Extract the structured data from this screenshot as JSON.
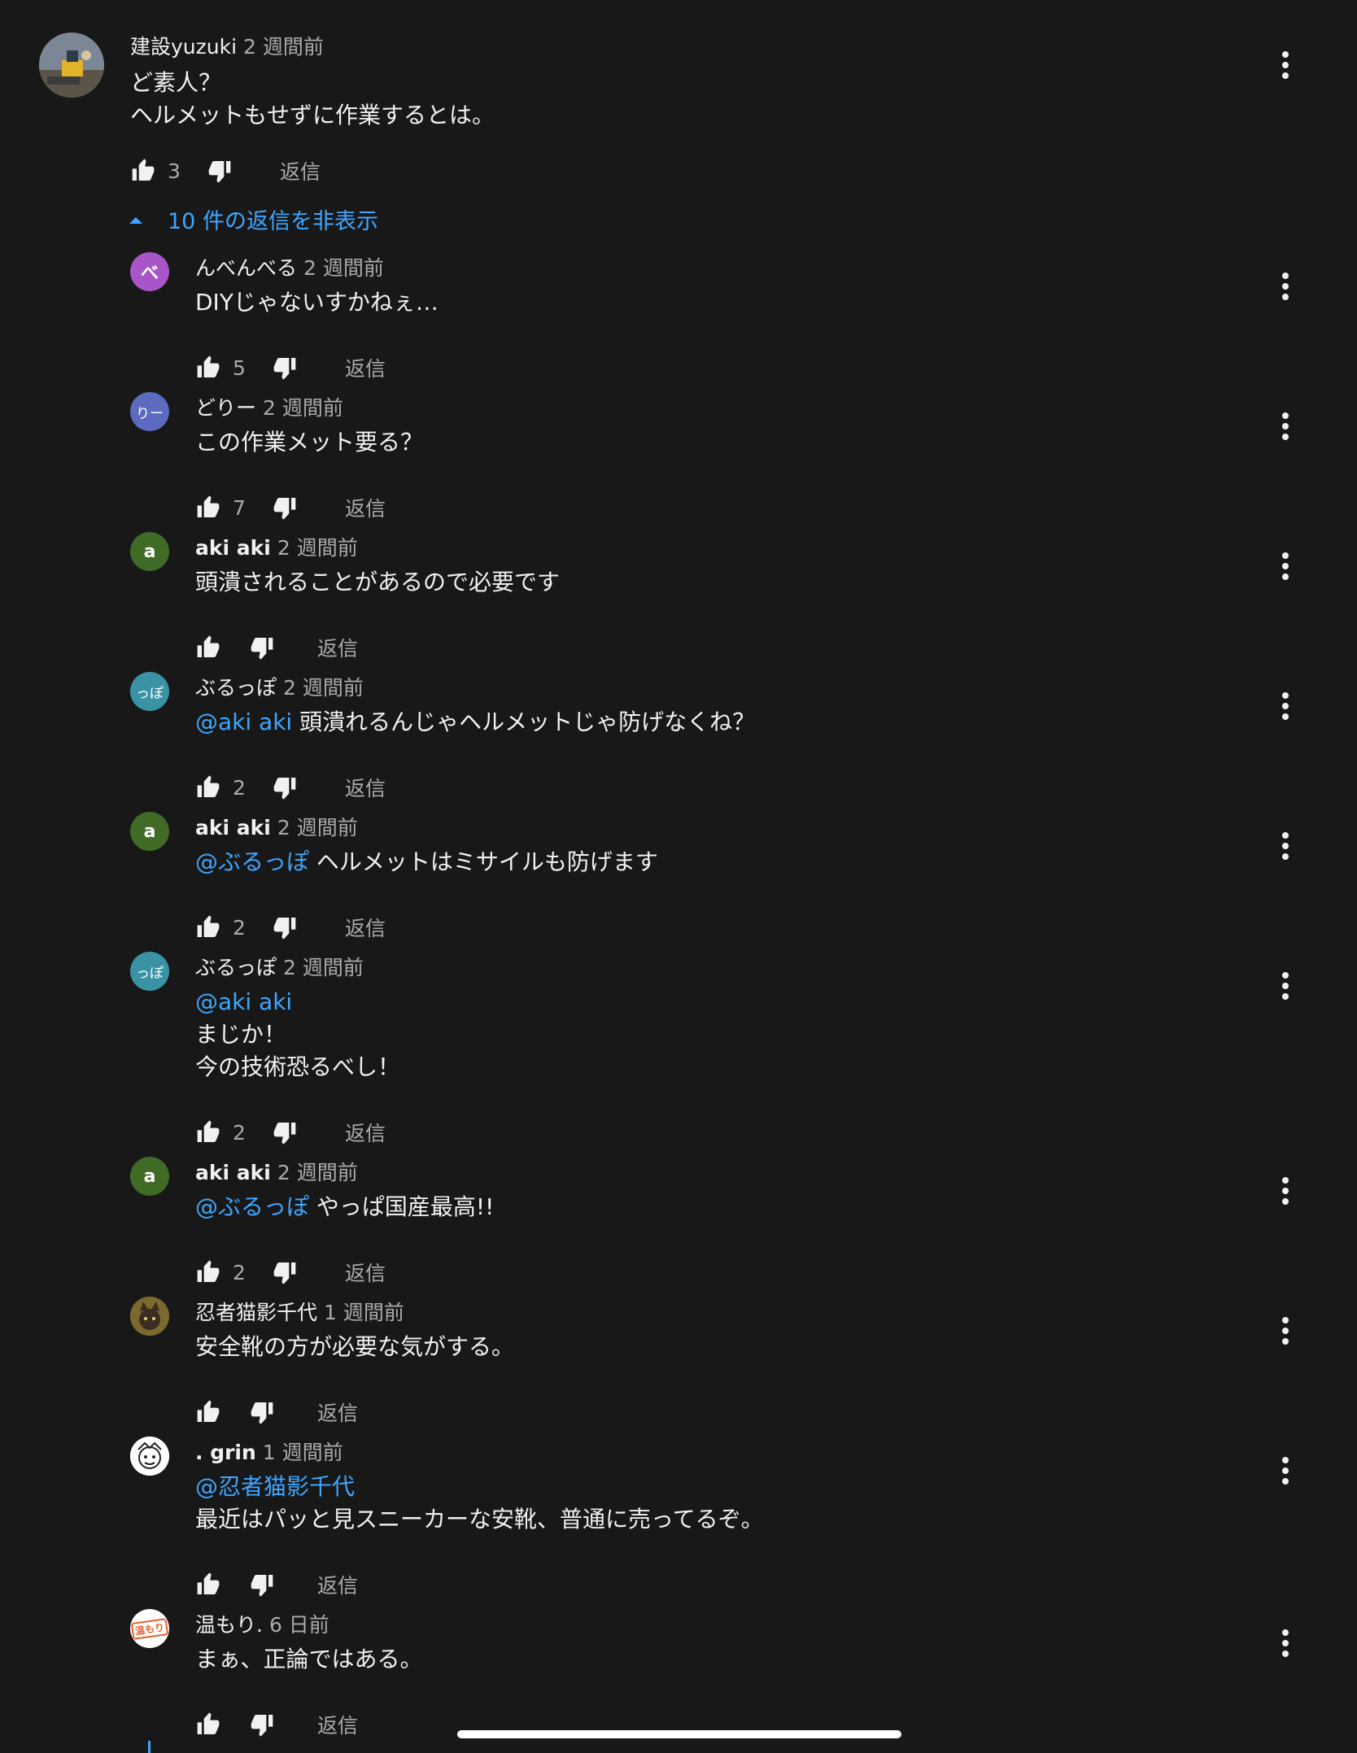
{
  "top_comment": {
    "author": "建設yuzuki",
    "time": "2 週間前",
    "text": "ど素人？\nヘルメットもせずに作業するとは。",
    "likes": "3",
    "reply_label": "返信",
    "avatar_icon": "construction-photo-avatar"
  },
  "replies_toggle": {
    "label": "10 件の返信を非表示",
    "icon": "caret-up-icon"
  },
  "replies": [
    {
      "author": "んべんべる",
      "author_bold": false,
      "time": "2 週間前",
      "mention": "",
      "text": "DIYじゃないすかねぇ…",
      "likes": "5",
      "reply_label": "返信",
      "avatar_text": "べ",
      "avatar_color": "#a855c8"
    },
    {
      "author": "どりー",
      "author_bold": false,
      "time": "2 週間前",
      "mention": "",
      "text": "この作業メット要る？",
      "likes": "7",
      "reply_label": "返信",
      "avatar_text": "りー",
      "avatar_color": "#5c6bc0"
    },
    {
      "author": "aki aki",
      "author_bold": true,
      "time": "2 週間前",
      "mention": "",
      "text": "頭潰されることがあるので必要です",
      "likes": "",
      "reply_label": "返信",
      "avatar_text": "a",
      "avatar_color": "#3f6b27"
    },
    {
      "author": "ぶるっぽ",
      "author_bold": false,
      "time": "2 週間前",
      "mention": "@aki aki",
      "text": "頭潰れるんじゃヘルメットじゃ防げなくね？",
      "likes": "2",
      "reply_label": "返信",
      "avatar_text": "っぽ",
      "avatar_color": "#3a93a4"
    },
    {
      "author": "aki aki",
      "author_bold": true,
      "time": "2 週間前",
      "mention": "@ぶるっぽ",
      "text": "ヘルメットはミサイルも防げます",
      "likes": "2",
      "reply_label": "返信",
      "avatar_text": "a",
      "avatar_color": "#3f6b27"
    },
    {
      "author": "ぶるっぽ",
      "author_bold": false,
      "time": "2 週間前",
      "mention": "@aki aki",
      "mention_newline": true,
      "text": "まじか！\n今の技術恐るべし！",
      "likes": "2",
      "reply_label": "返信",
      "avatar_text": "っぽ",
      "avatar_color": "#3a93a4"
    },
    {
      "author": "aki aki",
      "author_bold": true,
      "time": "2 週間前",
      "mention": "@ぶるっぽ",
      "text": "やっぱ国産最高!!",
      "likes": "2",
      "reply_label": "返信",
      "avatar_text": "a",
      "avatar_color": "#3f6b27"
    },
    {
      "author": "忍者猫影千代",
      "author_bold": false,
      "time": "1 週間前",
      "mention": "",
      "text": "安全靴の方が必要な気がする。",
      "likes": "",
      "reply_label": "返信",
      "avatar_text": "",
      "avatar_color": "#8a7a3a"
    },
    {
      "author": ". grin",
      "author_bold": true,
      "time": "1 週間前",
      "mention": "@忍者猫影千代",
      "mention_newline": true,
      "text": "最近はパッと見スニーカーな安靴、普通に売ってるぞ。",
      "likes": "",
      "reply_label": "返信",
      "avatar_text": "",
      "avatar_color": "#ffffff"
    },
    {
      "author": "温もり.",
      "author_bold": false,
      "time": "6 日前",
      "mention": "",
      "text": "まぁ、正論ではある。",
      "likes": "",
      "reply_label": "返信",
      "avatar_text": "温もり",
      "avatar_color": "#ffffff"
    }
  ],
  "colors": {
    "background": "#181818",
    "text": "#f1f1f1",
    "secondary": "#aaaaaa",
    "link": "#3ea6ff"
  }
}
